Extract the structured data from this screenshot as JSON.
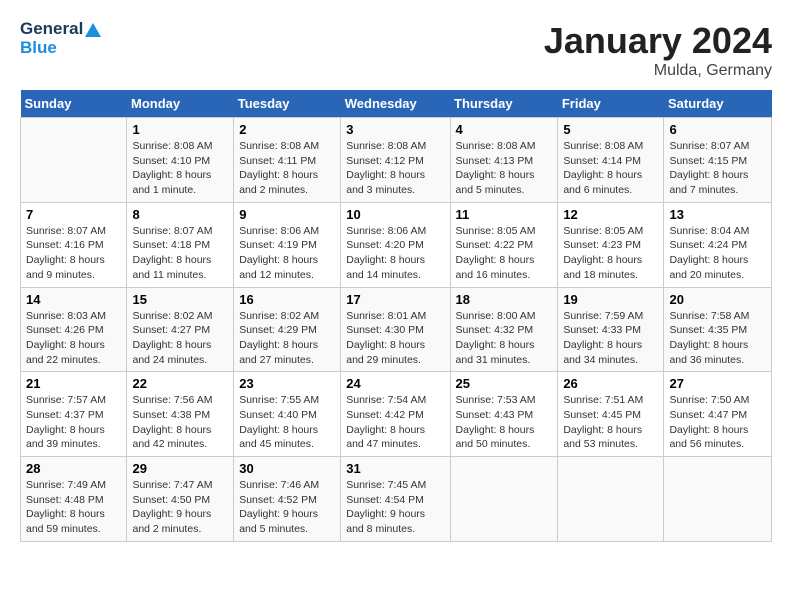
{
  "header": {
    "logo_line1": "General",
    "logo_line2": "Blue",
    "month": "January 2024",
    "location": "Mulda, Germany"
  },
  "weekdays": [
    "Sunday",
    "Monday",
    "Tuesday",
    "Wednesday",
    "Thursday",
    "Friday",
    "Saturday"
  ],
  "weeks": [
    [
      {
        "day": "",
        "info": ""
      },
      {
        "day": "1",
        "info": "Sunrise: 8:08 AM\nSunset: 4:10 PM\nDaylight: 8 hours\nand 1 minute."
      },
      {
        "day": "2",
        "info": "Sunrise: 8:08 AM\nSunset: 4:11 PM\nDaylight: 8 hours\nand 2 minutes."
      },
      {
        "day": "3",
        "info": "Sunrise: 8:08 AM\nSunset: 4:12 PM\nDaylight: 8 hours\nand 3 minutes."
      },
      {
        "day": "4",
        "info": "Sunrise: 8:08 AM\nSunset: 4:13 PM\nDaylight: 8 hours\nand 5 minutes."
      },
      {
        "day": "5",
        "info": "Sunrise: 8:08 AM\nSunset: 4:14 PM\nDaylight: 8 hours\nand 6 minutes."
      },
      {
        "day": "6",
        "info": "Sunrise: 8:07 AM\nSunset: 4:15 PM\nDaylight: 8 hours\nand 7 minutes."
      }
    ],
    [
      {
        "day": "7",
        "info": "Sunrise: 8:07 AM\nSunset: 4:16 PM\nDaylight: 8 hours\nand 9 minutes."
      },
      {
        "day": "8",
        "info": "Sunrise: 8:07 AM\nSunset: 4:18 PM\nDaylight: 8 hours\nand 11 minutes."
      },
      {
        "day": "9",
        "info": "Sunrise: 8:06 AM\nSunset: 4:19 PM\nDaylight: 8 hours\nand 12 minutes."
      },
      {
        "day": "10",
        "info": "Sunrise: 8:06 AM\nSunset: 4:20 PM\nDaylight: 8 hours\nand 14 minutes."
      },
      {
        "day": "11",
        "info": "Sunrise: 8:05 AM\nSunset: 4:22 PM\nDaylight: 8 hours\nand 16 minutes."
      },
      {
        "day": "12",
        "info": "Sunrise: 8:05 AM\nSunset: 4:23 PM\nDaylight: 8 hours\nand 18 minutes."
      },
      {
        "day": "13",
        "info": "Sunrise: 8:04 AM\nSunset: 4:24 PM\nDaylight: 8 hours\nand 20 minutes."
      }
    ],
    [
      {
        "day": "14",
        "info": "Sunrise: 8:03 AM\nSunset: 4:26 PM\nDaylight: 8 hours\nand 22 minutes."
      },
      {
        "day": "15",
        "info": "Sunrise: 8:02 AM\nSunset: 4:27 PM\nDaylight: 8 hours\nand 24 minutes."
      },
      {
        "day": "16",
        "info": "Sunrise: 8:02 AM\nSunset: 4:29 PM\nDaylight: 8 hours\nand 27 minutes."
      },
      {
        "day": "17",
        "info": "Sunrise: 8:01 AM\nSunset: 4:30 PM\nDaylight: 8 hours\nand 29 minutes."
      },
      {
        "day": "18",
        "info": "Sunrise: 8:00 AM\nSunset: 4:32 PM\nDaylight: 8 hours\nand 31 minutes."
      },
      {
        "day": "19",
        "info": "Sunrise: 7:59 AM\nSunset: 4:33 PM\nDaylight: 8 hours\nand 34 minutes."
      },
      {
        "day": "20",
        "info": "Sunrise: 7:58 AM\nSunset: 4:35 PM\nDaylight: 8 hours\nand 36 minutes."
      }
    ],
    [
      {
        "day": "21",
        "info": "Sunrise: 7:57 AM\nSunset: 4:37 PM\nDaylight: 8 hours\nand 39 minutes."
      },
      {
        "day": "22",
        "info": "Sunrise: 7:56 AM\nSunset: 4:38 PM\nDaylight: 8 hours\nand 42 minutes."
      },
      {
        "day": "23",
        "info": "Sunrise: 7:55 AM\nSunset: 4:40 PM\nDaylight: 8 hours\nand 45 minutes."
      },
      {
        "day": "24",
        "info": "Sunrise: 7:54 AM\nSunset: 4:42 PM\nDaylight: 8 hours\nand 47 minutes."
      },
      {
        "day": "25",
        "info": "Sunrise: 7:53 AM\nSunset: 4:43 PM\nDaylight: 8 hours\nand 50 minutes."
      },
      {
        "day": "26",
        "info": "Sunrise: 7:51 AM\nSunset: 4:45 PM\nDaylight: 8 hours\nand 53 minutes."
      },
      {
        "day": "27",
        "info": "Sunrise: 7:50 AM\nSunset: 4:47 PM\nDaylight: 8 hours\nand 56 minutes."
      }
    ],
    [
      {
        "day": "28",
        "info": "Sunrise: 7:49 AM\nSunset: 4:48 PM\nDaylight: 8 hours\nand 59 minutes."
      },
      {
        "day": "29",
        "info": "Sunrise: 7:47 AM\nSunset: 4:50 PM\nDaylight: 9 hours\nand 2 minutes."
      },
      {
        "day": "30",
        "info": "Sunrise: 7:46 AM\nSunset: 4:52 PM\nDaylight: 9 hours\nand 5 minutes."
      },
      {
        "day": "31",
        "info": "Sunrise: 7:45 AM\nSunset: 4:54 PM\nDaylight: 9 hours\nand 8 minutes."
      },
      {
        "day": "",
        "info": ""
      },
      {
        "day": "",
        "info": ""
      },
      {
        "day": "",
        "info": ""
      }
    ]
  ]
}
